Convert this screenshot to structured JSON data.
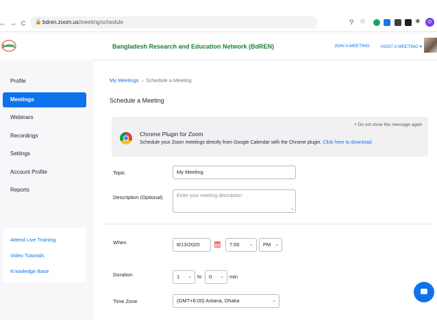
{
  "browser": {
    "back": "←",
    "forward": "→",
    "reload": "C",
    "url_host": "bdren.zoom.us",
    "url_path": "/meeting/schedule",
    "profile_initial": "D"
  },
  "header": {
    "logo_text": "BdREN",
    "org_title": "Bangladesh Research and Education Network (BdREN)",
    "join_meeting": "JOIN A MEETING",
    "host_meeting": "HOST A MEETING ▾"
  },
  "sidebar": {
    "items": [
      {
        "label": "Profile"
      },
      {
        "label": "Meetings"
      },
      {
        "label": "Webinars"
      },
      {
        "label": "Recordings"
      },
      {
        "label": "Settings"
      },
      {
        "label": "Account Profile"
      },
      {
        "label": "Reports"
      }
    ],
    "active_index": 1,
    "help_links": [
      {
        "label": "Attend Live Training"
      },
      {
        "label": "Video Tutorials"
      },
      {
        "label": "Knowledge Base"
      }
    ]
  },
  "breadcrumb": {
    "parent": "My Meetings",
    "separator": "›",
    "current": "Schedule a Meeting"
  },
  "page_heading": "Schedule a Meeting",
  "plugin_banner": {
    "title": "Chrome Plugin for Zoom",
    "description": "Schedule your Zoom meetings directly from Google Calendar with the Chrome plugin.",
    "link": "Click here to download.",
    "dismiss": "× Do not show this message again"
  },
  "form": {
    "topic_label": "Topic",
    "topic_value": "My Meeting",
    "description_label": "Description (Optional)",
    "description_placeholder": "Enter your meeting description",
    "when_label": "When",
    "date_value": "8/13/2020",
    "time_value": "7:00",
    "ampm_value": "PM",
    "duration_label": "Duration",
    "hours_value": "1",
    "hours_unit": "hr",
    "minutes_value": "0",
    "minutes_unit": "min",
    "timezone_label": "Time Zone",
    "timezone_value": "(GMT+6:00) Astana, Dhaka"
  },
  "colors": {
    "accent": "#0e72ed",
    "org_green": "#1b7f3a",
    "sidebar_bg": "#f7f7fa"
  }
}
